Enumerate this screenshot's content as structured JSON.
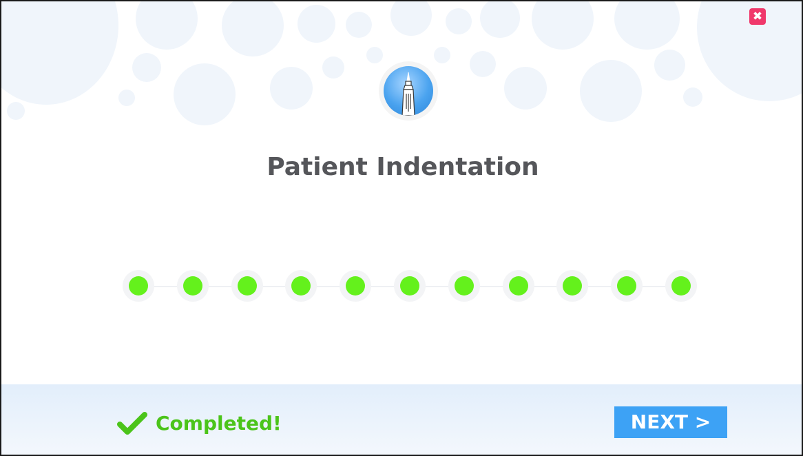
{
  "window": {
    "close_icon": "close-icon",
    "close_glyph": "✖"
  },
  "header": {
    "logo_icon": "needle-syringe-icon",
    "title": "Patient Indentation"
  },
  "progress": {
    "total_steps": 11,
    "completed_steps": 11,
    "step_color": "#64f11c"
  },
  "footer": {
    "status_icon": "checkmark-icon",
    "status_text": "Completed!",
    "next_label": "NEXT >"
  },
  "colors": {
    "accent": "#3da2f5",
    "success": "#4bc41a",
    "close": "#f0386b",
    "title_text": "#55565a"
  }
}
